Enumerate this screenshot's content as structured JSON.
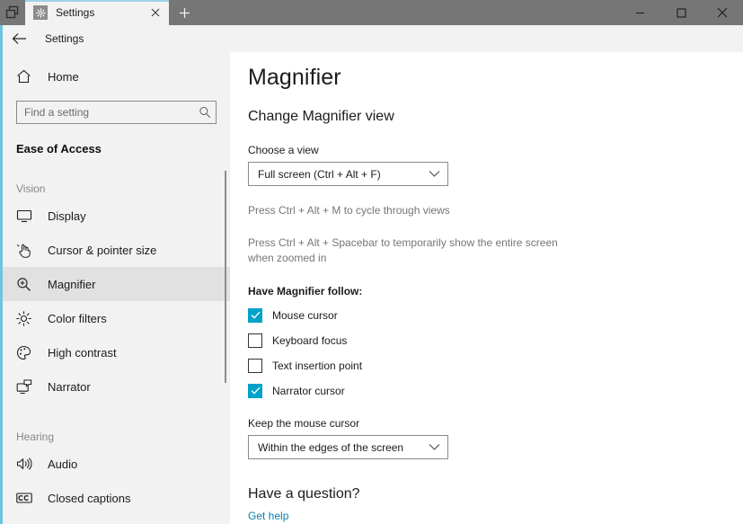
{
  "window": {
    "sets_button_icon": "tab-switcher-icon",
    "tabs": [
      {
        "title": "Settings",
        "icon": "gear-icon",
        "close_icon": "close-icon",
        "active": true
      }
    ],
    "new_tab_icon": "plus-icon",
    "controls": {
      "minimize_icon": "minimize-icon",
      "maximize_icon": "maximize-icon",
      "close_icon": "close-icon"
    }
  },
  "header": {
    "back_icon": "back-arrow-icon",
    "title": "Settings"
  },
  "sidebar": {
    "home": {
      "label": "Home",
      "icon": "home-icon"
    },
    "search": {
      "placeholder": "Find a setting",
      "value": "",
      "icon": "search-icon"
    },
    "section_title": "Ease of Access",
    "groups": [
      {
        "label": "Vision",
        "items": [
          {
            "label": "Display",
            "icon": "monitor-icon",
            "selected": false
          },
          {
            "label": "Cursor & pointer size",
            "icon": "hand-pointer-icon",
            "selected": false
          },
          {
            "label": "Magnifier",
            "icon": "magnifier-icon",
            "selected": true
          },
          {
            "label": "Color filters",
            "icon": "brightness-icon",
            "selected": false
          },
          {
            "label": "High contrast",
            "icon": "contrast-palette-icon",
            "selected": false
          },
          {
            "label": "Narrator",
            "icon": "narrator-icon",
            "selected": false
          }
        ]
      },
      {
        "label": "Hearing",
        "items": [
          {
            "label": "Audio",
            "icon": "speaker-icon",
            "selected": false
          },
          {
            "label": "Closed captions",
            "icon": "closed-captions-icon",
            "selected": false
          }
        ]
      }
    ]
  },
  "main": {
    "page_title": "Magnifier",
    "section_heading": "Change Magnifier view",
    "choose_view": {
      "label": "Choose a view",
      "value": "Full screen (Ctrl + Alt + F)",
      "chevron_icon": "chevron-down-icon"
    },
    "hint_1": "Press Ctrl + Alt + M to cycle through views",
    "hint_2": "Press Ctrl + Alt + Spacebar to temporarily show the entire screen when zoomed in",
    "follow_label": "Have Magnifier follow:",
    "follow_options": [
      {
        "label": "Mouse cursor",
        "checked": true
      },
      {
        "label": "Keyboard focus",
        "checked": false
      },
      {
        "label": "Text insertion point",
        "checked": false
      },
      {
        "label": "Narrator cursor",
        "checked": true
      }
    ],
    "keep_cursor": {
      "label": "Keep the mouse cursor",
      "value": "Within the edges of the screen",
      "chevron_icon": "chevron-down-icon"
    },
    "question": {
      "heading": "Have a question?",
      "link": "Get help"
    }
  },
  "colors": {
    "accent": "#00a2c7",
    "link": "#0a7ca8",
    "titlebar": "#767676",
    "sidebar_bg": "#f2f2f2"
  }
}
